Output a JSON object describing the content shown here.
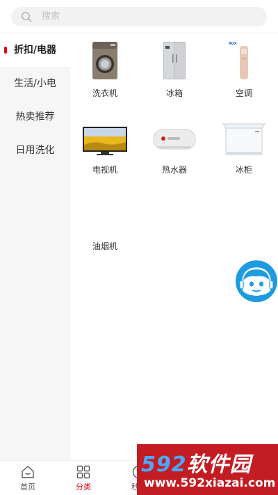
{
  "search": {
    "placeholder": "搜索",
    "icon": "search-icon"
  },
  "sidebar": {
    "items": [
      {
        "label": "折扣/电器",
        "active": true
      },
      {
        "label": "生活/小电",
        "active": false
      },
      {
        "label": "热卖推荐",
        "active": false
      },
      {
        "label": "日用洗化",
        "active": false
      }
    ]
  },
  "products": [
    {
      "name": "洗衣机",
      "icon": "washing-machine-icon"
    },
    {
      "name": "冰箱",
      "icon": "refrigerator-icon"
    },
    {
      "name": "空调",
      "icon": "air-conditioner-icon"
    },
    {
      "name": "电视机",
      "icon": "television-icon"
    },
    {
      "name": "热水器",
      "icon": "water-heater-icon"
    },
    {
      "name": "冰柜",
      "icon": "freezer-icon"
    },
    {
      "name": "油烟机",
      "icon": "range-hood-icon"
    }
  ],
  "service": {
    "icon": "customer-service-icon"
  },
  "tabbar": {
    "tabs": [
      {
        "label": "首页",
        "icon": "home-icon",
        "active": false
      },
      {
        "label": "分类",
        "icon": "category-icon",
        "active": true
      },
      {
        "label": "秒杀",
        "icon": "clock-icon",
        "active": false
      }
    ]
  },
  "watermark": {
    "brand_num": "592",
    "brand_text": "软件园",
    "url": "www.592xiazai.com"
  },
  "colors": {
    "accent": "#e60012",
    "sidebar_bg": "#f6f6f6",
    "service_blue": "#1e9be0"
  }
}
